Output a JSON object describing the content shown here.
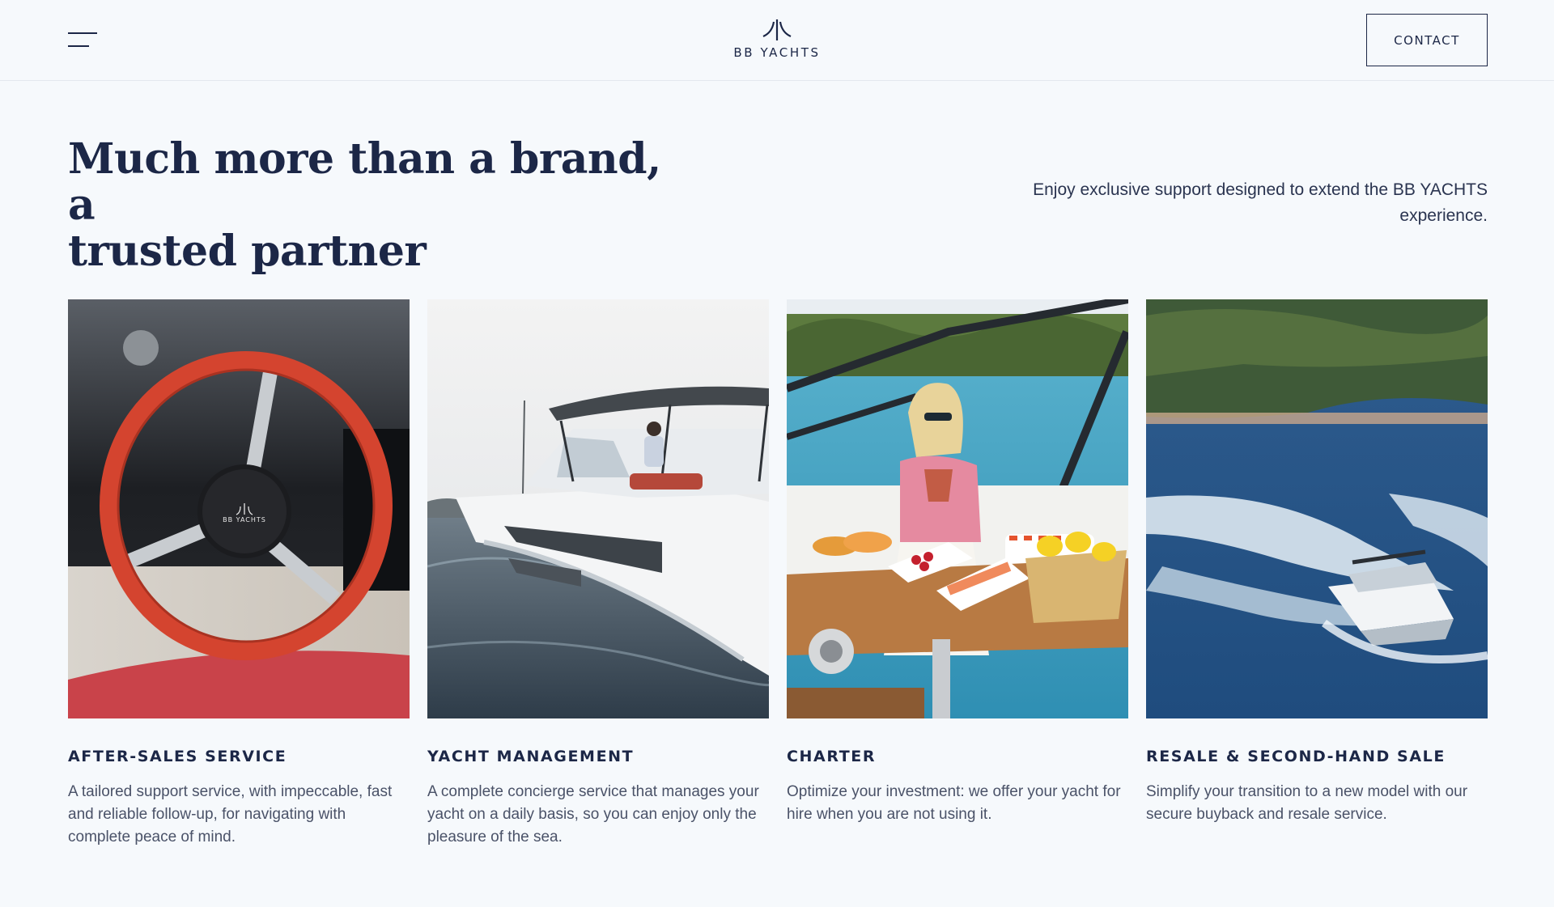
{
  "header": {
    "logo_text": "BB YACHTS",
    "contact_label": "CONTACT"
  },
  "hero": {
    "headline_line1": "Much more than a brand, a",
    "headline_line2": "trusted partner",
    "intro": "Enjoy exclusive support designed to extend the BB YACHTS experience."
  },
  "services": [
    {
      "title": "AFTER-SALES SERVICE",
      "description": " A tailored support service, with impeccable, fast and reliable follow-up, for navigating with complete peace of mind.",
      "image": "steering-wheel-photo",
      "wheel_badge": "BB YACHTS"
    },
    {
      "title": "YACHT MANAGEMENT",
      "description": "A complete concierge service that manages your yacht on a daily basis, so you can enjoy only the pleasure of the sea.",
      "image": "yacht-at-sea-photo"
    },
    {
      "title": "CHARTER",
      "description": "Optimize your investment: we offer your yacht for hire when you are not using it.",
      "image": "woman-dining-on-deck-photo"
    },
    {
      "title": "RESALE & SECOND-HAND SALE",
      "description": "Simplify your transition to a new model with our secure buyback and resale service.",
      "image": "speedboat-wake-photo"
    }
  ],
  "colors": {
    "background": "#f6f9fc",
    "navy": "#1c2747",
    "body_text": "#4a5268"
  }
}
